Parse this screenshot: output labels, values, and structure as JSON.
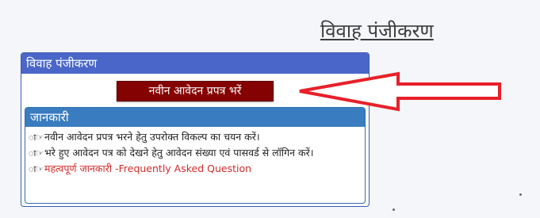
{
  "page": {
    "heading": "विवाह पंजीकरण"
  },
  "panel": {
    "title": "विवाह पंजीकरण",
    "apply_button": "नवीन आवेदन प्रपत्र भरें"
  },
  "info": {
    "title": "जानकारी",
    "items": [
      {
        "bullet": "ा☞",
        "text": "नवीन आवेदन प्रपत्र भरने हेतु उपरोक्त विकल्प का चयन करें।"
      },
      {
        "bullet": "ा☞",
        "text": "भरे हुए आवेदन पत्र को देखने हेतु आवेदन संख्या एवं पासवर्ड से लॉगिन करें।"
      }
    ],
    "faq": {
      "bullet": "ा☞",
      "text": "महत्वपूर्ण जानकारी -Frequently Asked Question"
    }
  },
  "colors": {
    "panel_header": "#4a66c8",
    "info_header": "#3a7cc0",
    "button": "#850202",
    "arrow": "#e8202a",
    "faq_link": "#d42a2a"
  }
}
